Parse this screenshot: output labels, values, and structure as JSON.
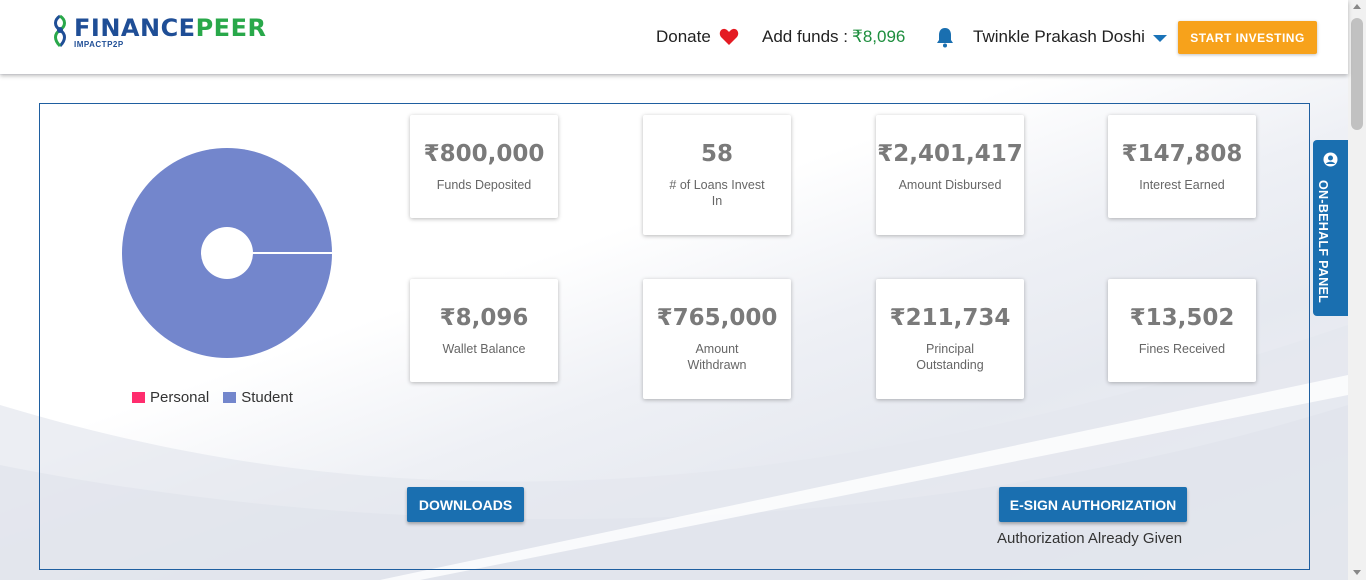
{
  "header": {
    "logo_main": "FINANCE",
    "logo_accent": "PEER",
    "logo_sub": "IMPACTP2P",
    "donate_label": "Donate",
    "add_funds_label": "Add funds :",
    "add_funds_amount": "₹8,096",
    "user_name": "Twinkle Prakash Doshi",
    "start_investing_label": "START INVESTING",
    "icons": [
      "heart-icon",
      "bell-icon",
      "caret-down-icon"
    ]
  },
  "chart_data": {
    "type": "pie",
    "title": "",
    "series": [
      {
        "name": "Personal",
        "value": 0,
        "color": "#ff2d6e"
      },
      {
        "name": "Student",
        "value": 100,
        "color": "#7386cc"
      }
    ]
  },
  "stats": [
    {
      "value": "₹800,000",
      "label": "Funds Deposited"
    },
    {
      "value": "58",
      "label": "# of Loans Invest In"
    },
    {
      "value": "₹2,401,417",
      "label": "Amount Disbursed"
    },
    {
      "value": "₹147,808",
      "label": "Interest Earned"
    },
    {
      "value": "₹8,096",
      "label": "Wallet Balance"
    },
    {
      "value": "₹765,000",
      "label": "Amount Withdrawn"
    },
    {
      "value": "₹211,734",
      "label": "Principal Outstanding"
    },
    {
      "value": "₹13,502",
      "label": "Fines Received"
    }
  ],
  "actions": {
    "downloads_label": "DOWNLOADS",
    "esign_label": "E-SIGN AUTHORIZATION",
    "auth_status": "Authorization Already Given"
  },
  "side_panel": {
    "label": "ON-BEHALF PANEL"
  },
  "colors": {
    "brand_blue": "#1f4e96",
    "brand_green": "#29a84a",
    "accent_orange": "#f7a21b",
    "button_blue": "#1a6fb0"
  }
}
